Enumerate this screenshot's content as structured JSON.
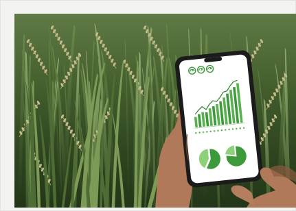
{
  "scene": {
    "subject": "",
    "colors": {
      "frame": "#f3f3f1",
      "field_dark": "#2f4620",
      "field_light": "#8fa86a",
      "grain": "#c9c08f",
      "phone_body": "#1b1b1b",
      "screen": "#ffffff",
      "chart_green": "#3c9a3a",
      "chart_light": "#8fd17a",
      "skin": "#b07a5a",
      "skin_shadow": "#8a5a40"
    }
  },
  "phone": {
    "icons": [
      "gauge-icon",
      "gauge-icon",
      "gauge-icon"
    ],
    "chart_data": {
      "type": "bar",
      "values": [
        18,
        22,
        25,
        24,
        30,
        33,
        36,
        40,
        46,
        52,
        58,
        62,
        68
      ]
    },
    "pie_charts": [
      {
        "slices": [
          0.58,
          0.42
        ]
      },
      {
        "slices": [
          0.78,
          0.22
        ]
      }
    ]
  }
}
